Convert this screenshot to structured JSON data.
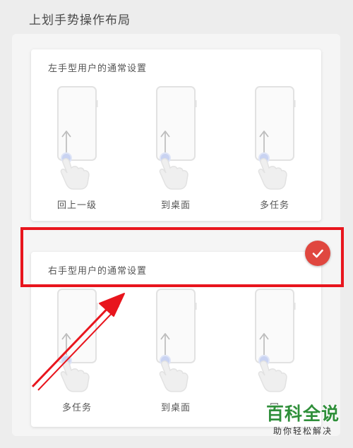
{
  "page": {
    "title": "上划手势操作布局"
  },
  "options": [
    {
      "title": "左手型用户的通常设置",
      "selected": false,
      "gestures": [
        {
          "label": "回上一级"
        },
        {
          "label": "到桌面"
        },
        {
          "label": "多任务"
        }
      ]
    },
    {
      "title": "右手型用户的通常设置",
      "selected": true,
      "gestures": [
        {
          "label": "多任务"
        },
        {
          "label": "到桌面"
        },
        {
          "label": "回"
        }
      ]
    }
  ],
  "watermark": {
    "main": "百科全说",
    "sub": "助你轻松解决"
  },
  "colors": {
    "accent_check": "#e0473f",
    "annotation_red": "#e8151d",
    "watermark_green": "#2f8f3a"
  },
  "icons": {
    "phone": "phone-outline-icon",
    "swipe_up": "arrow-up-icon",
    "touch": "finger-touch-icon",
    "selected": "check-icon"
  }
}
